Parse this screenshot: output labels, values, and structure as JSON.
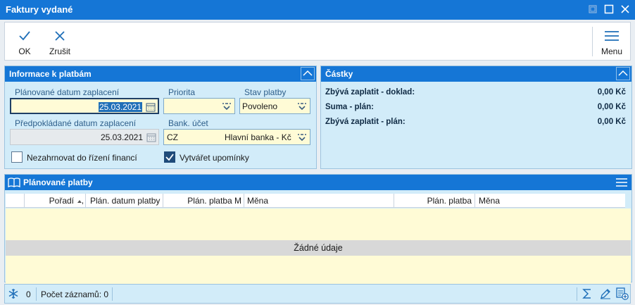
{
  "window": {
    "title": "Faktury vydané"
  },
  "toolbar": {
    "ok_label": "OK",
    "cancel_label": "Zrušit",
    "menu_label": "Menu"
  },
  "payment_info": {
    "title": "Informace k platbám",
    "planned_date_label": "Plánované datum zaplacení",
    "planned_date_value": "25.03.2021",
    "priority_label": "Priorita",
    "priority_value": "",
    "payment_state_label": "Stav platby",
    "payment_state_value": "Povoleno",
    "expected_date_label": "Předpokládané datum zaplacení",
    "expected_date_value": "25.03.2021",
    "bank_account_label": "Bank. účet",
    "bank_account_code": "CZ",
    "bank_account_name": "Hlavní banka - Kč",
    "exclude_label": "Nezahrnovat do řízení financí",
    "exclude_checked": false,
    "reminders_label": "Vytvářet upomínky",
    "reminders_checked": true
  },
  "amounts": {
    "title": "Částky",
    "rows": [
      {
        "label": "Zbývá zaplatit - doklad:",
        "value": "0,00 Kč"
      },
      {
        "label": "Suma - plán:",
        "value": "0,00 Kč"
      },
      {
        "label": "Zbývá zaplatit - plán:",
        "value": "0,00 Kč"
      }
    ]
  },
  "planned_payments": {
    "title": "Plánované platby",
    "columns": [
      "Pořadí",
      "Plán. datum platby",
      "Plán. platba M",
      "Měna",
      "Plán. platba",
      "Měna"
    ],
    "empty_text": "Žádné údaje"
  },
  "statusbar": {
    "selected_count": "0",
    "record_count_text": "Počet záznamů: 0"
  },
  "colors": {
    "accent": "#1576d6",
    "panel_bg": "#d2ecf9",
    "field_bg": "#fffbd6"
  }
}
